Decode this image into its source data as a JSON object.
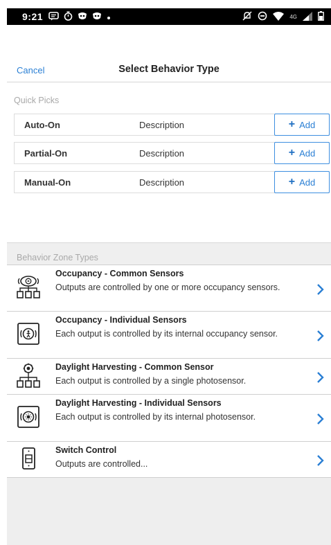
{
  "statusbar": {
    "time": "9:21",
    "network": "4G"
  },
  "header": {
    "cancel_label": "Cancel",
    "title": "Select Behavior Type"
  },
  "quick_picks": {
    "label": "Quick Picks",
    "items": [
      {
        "name": "Auto-On",
        "description": "Description",
        "add_label": "Add"
      },
      {
        "name": "Partial-On",
        "description": "Description",
        "add_label": "Add"
      },
      {
        "name": "Manual-On",
        "description": "Description",
        "add_label": "Add"
      }
    ]
  },
  "zone_types": {
    "label": "Behavior Zone Types",
    "items": [
      {
        "title": "Occupancy - Common Sensors",
        "description": "Outputs are controlled by one or more occupancy sensors.",
        "icon": "occupancy-common-sensors-icon"
      },
      {
        "title": "Occupancy - Individual Sensors",
        "description": "Each output is controlled by its internal occupancy sensor.",
        "icon": "occupancy-individual-sensor-icon"
      },
      {
        "title": "Daylight Harvesting - Common Sensor",
        "description": "Each output is controlled by a single photosensor.",
        "icon": "daylight-common-sensor-icon"
      },
      {
        "title": "Daylight Harvesting - Individual Sensors",
        "description": "Each output is controlled by its internal photosensor.",
        "icon": "daylight-individual-sensor-icon"
      },
      {
        "title": "Switch Control",
        "description": "Outputs are controlled...",
        "icon": "switch-control-icon"
      }
    ]
  },
  "colors": {
    "accent": "#2a7fd4",
    "section_label": "#a9a9a9",
    "band": "#efefef"
  }
}
